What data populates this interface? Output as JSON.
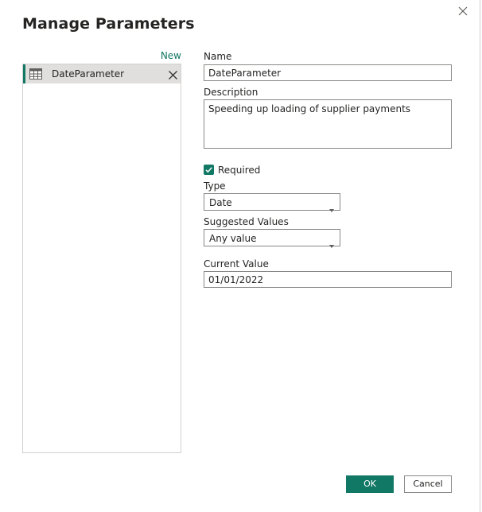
{
  "dialog": {
    "title": "Manage Parameters"
  },
  "sidebar": {
    "new_label": "New",
    "items": [
      {
        "label": "DateParameter",
        "icon": "table-icon",
        "selected": true
      }
    ]
  },
  "form": {
    "name_label": "Name",
    "name_value": "DateParameter",
    "description_label": "Description",
    "description_value": "Speeding up loading of supplier payments",
    "required_label": "Required",
    "required_checked": true,
    "type_label": "Type",
    "type_value": "Date",
    "suggested_label": "Suggested Values",
    "suggested_value": "Any value",
    "current_label": "Current Value",
    "current_value": "01/01/2022"
  },
  "footer": {
    "ok_label": "OK",
    "cancel_label": "Cancel"
  },
  "colors": {
    "accent": "#117865",
    "selected_bg": "#e1dfdd",
    "border": "#8a8886"
  }
}
